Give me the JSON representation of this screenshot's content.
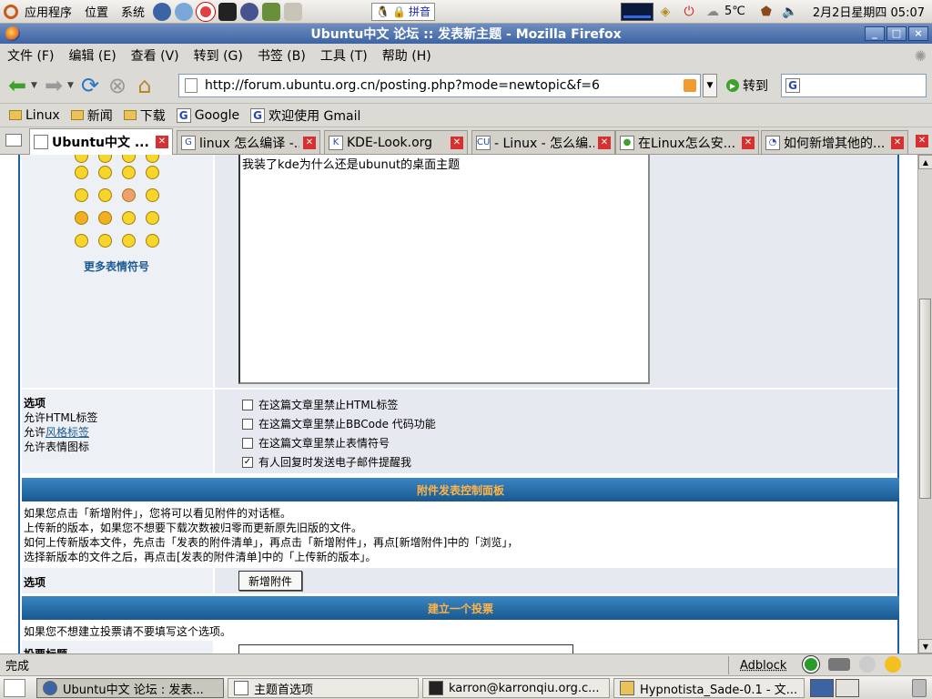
{
  "top_panel": {
    "menus": [
      "应用程序",
      "位置",
      "系统"
    ],
    "ime": "拼音",
    "weather": "5℃",
    "clock": "2月2日星期四 05:07"
  },
  "window": {
    "title": "Ubuntu中文 论坛 :: 发表新主题 - Mozilla Firefox",
    "controls": [
      "_",
      "□",
      "×"
    ]
  },
  "menubar": [
    "文件 (F)",
    "编辑 (E)",
    "查看 (V)",
    "转到 (G)",
    "书签 (B)",
    "工具 (T)",
    "帮助 (H)"
  ],
  "navbar": {
    "url": "http://forum.ubuntu.org.cn/posting.php?mode=newtopic&f=6",
    "go_label": "转到",
    "search_value": ""
  },
  "bookmarks": [
    {
      "label": "Linux",
      "icon": "folder-icon"
    },
    {
      "label": "新闻",
      "icon": "folder-icon"
    },
    {
      "label": "下载",
      "icon": "folder-icon"
    },
    {
      "label": "Google",
      "icon": "google-icon"
    },
    {
      "label": "欢迎使用 Gmail",
      "icon": "google-icon"
    }
  ],
  "tabs": [
    {
      "label": "Ubuntu中文 ...",
      "active": true
    },
    {
      "label": "linux 怎么编译 -...",
      "active": false
    },
    {
      "label": "KDE-Look.org",
      "active": false
    },
    {
      "label": "- Linux - 怎么编...",
      "active": false
    },
    {
      "label": "在Linux怎么安...",
      "active": false
    },
    {
      "label": "如何新增其他的...",
      "active": false
    }
  ],
  "content": {
    "more_smilies": "更多表情符号",
    "textarea_text": "我装了kde为什么还是ubunut的桌面主题",
    "options_title": "选项",
    "options_lines": {
      "html": "允许HTML标签",
      "bbcode_prefix": "允许",
      "bbcode_link": "风格标签",
      "smilies": "允许表情图标"
    },
    "checkboxes": [
      {
        "label": "在这篇文章里禁止HTML标签",
        "checked": false
      },
      {
        "label": "在这篇文章里禁止BBCode 代码功能",
        "checked": false
      },
      {
        "label": "在这篇文章里禁止表情符号",
        "checked": false
      },
      {
        "label": "有人回复时发送电子邮件提醒我",
        "checked": true
      }
    ],
    "attach_header": "附件发表控制面板",
    "attach_info": [
      "如果您点击「新增附件」，您将可以看见附件的对话框。",
      "上传新的版本，如果您不想要下载次数被归零而更新原先旧版的文件。",
      "如何上传新版本文件，先点击「发表的附件清单」，再点击「新增附件」，再点[新增附件]中的「浏览」，",
      "选择新版本的文件之后，再点击[发表的附件清单]中的「上传新的版本」。"
    ],
    "attach_option_label": "选项",
    "add_attachment_button": "新增附件",
    "poll_header": "建立一个投票",
    "poll_info": "如果您不想建立投票请不要填写这个选项。",
    "poll_title_label": "投票标题"
  },
  "statusbar": {
    "status": "完成",
    "adblock": "Adblock"
  },
  "taskbar": [
    {
      "label": "Ubuntu中文 论坛 : 发表...",
      "active": true
    },
    {
      "label": "主题首选项",
      "active": false
    },
    {
      "label": "karron@karronqiu.org.c...",
      "active": false
    },
    {
      "label": "Hypnotista_Sade-0.1 - 文...",
      "active": false
    }
  ],
  "colors": {
    "forum_blue": "#1e5ea8",
    "header_text": "#ffb347",
    "link": "#1c5a95"
  }
}
